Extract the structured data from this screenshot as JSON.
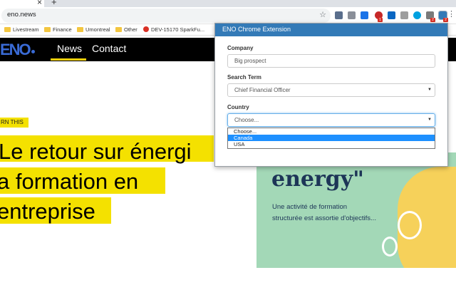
{
  "browser": {
    "tab_close": "×",
    "new_tab": "+",
    "url": "eno.news",
    "star": "☆",
    "menu": "⋮",
    "extension_badges": [
      "1",
      "2",
      "2"
    ],
    "bookmarks": [
      "Livestream",
      "Finance",
      "Umontreal",
      "Other",
      "DEV-15170 SparkFu..."
    ]
  },
  "site": {
    "logo": "ENO",
    "nav": [
      "News",
      "Contact"
    ],
    "badge": "RN THIS",
    "headline": [
      "Le retour sur énergi",
      "a formation en",
      "entreprise"
    ],
    "card": {
      "title": "energy\"",
      "subtitle_line1": "Une activité de formation",
      "subtitle_line2": "structurée est assortie d'objectifs..."
    }
  },
  "popup": {
    "title": "ENO Chrome Extension",
    "company_label": "Company",
    "company_value": "Big prospect",
    "search_term_label": "Search Term",
    "search_term_value": "Chief Financial Officer",
    "country_label": "Country",
    "country_value": "Choose...",
    "country_options": [
      "Choose...",
      "Canada",
      "USA"
    ],
    "selected_option": "Canada"
  },
  "colors": {
    "popup_header": "#337ab7",
    "highlight_yellow": "#f4e100",
    "card_green": "#a3d8b7",
    "option_highlight": "#1e90ff"
  }
}
